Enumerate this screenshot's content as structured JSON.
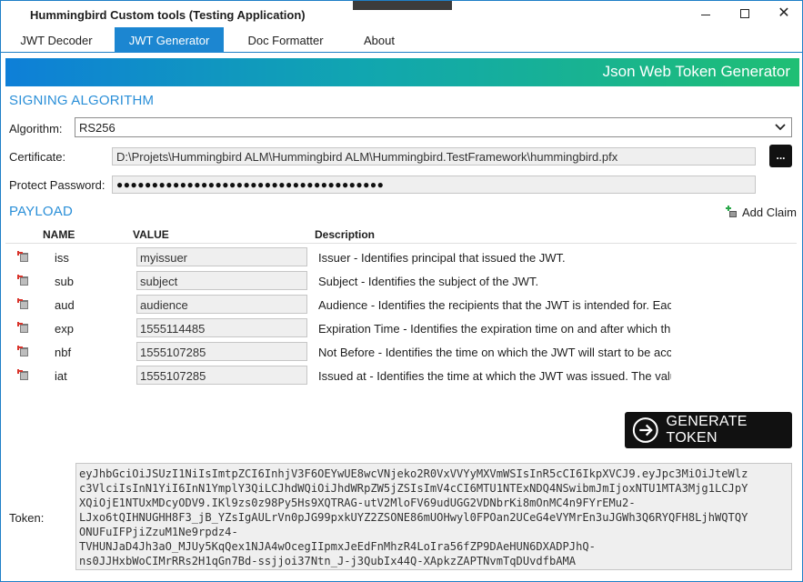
{
  "window": {
    "title": "Hummingbird Custom tools (Testing Application)"
  },
  "tabs": [
    {
      "label": "JWT Decoder"
    },
    {
      "label": "JWT Generator"
    },
    {
      "label": "Doc Formatter"
    },
    {
      "label": "About"
    }
  ],
  "active_tab": "JWT Generator",
  "header": {
    "title": "Json Web Token Generator"
  },
  "signing": {
    "section_title": "SIGNING ALGORITHM",
    "algorithm_label": "Algorithm:",
    "algorithm_value": "RS256",
    "certificate_label": "Certificate:",
    "certificate_value": "D:\\Projets\\Hummingbird ALM\\Hummingbird ALM\\Hummingbird.TestFramework\\hummingbird.pfx",
    "browse_label": "...",
    "password_label": "Protect Password:",
    "password_value": "●●●●●●●●●●●●●●●●●●●●●●●●●●●●●●●●●●●●●●"
  },
  "payload": {
    "section_title": "PAYLOAD",
    "add_claim_label": "Add Claim",
    "columns": {
      "name": "NAME",
      "value": "VALUE",
      "description": "Description"
    },
    "claims": [
      {
        "name": "iss",
        "value": "myissuer",
        "description": "Issuer - Identifies principal that issued the JWT."
      },
      {
        "name": "sub",
        "value": "subject",
        "description": "Subject - Identifies the subject of the JWT."
      },
      {
        "name": "aud",
        "value": "audience",
        "description": "Audience - Identifies the recipients that the JWT is intended for. Eac"
      },
      {
        "name": "exp",
        "value": "1555114485",
        "description": "Expiration Time - Identifies the expiration time on and after which th"
      },
      {
        "name": "nbf",
        "value": "1555107285",
        "description": "Not Before - Identifies the time on which the JWT will start to be acc"
      },
      {
        "name": "iat",
        "value": "1555107285",
        "description": "Issued at - Identifies the time at which the JWT was issued. The valu"
      }
    ]
  },
  "generate": {
    "label": "GENERATE TOKEN"
  },
  "token": {
    "label": "Token:",
    "value": "eyJhbGciOiJSUzI1NiIsImtpZCI6InhjV3F6OEYwUE8wcVNjeko2R0VxVVYyMXVmWSIsInR5cCI6IkpXVCJ9.eyJpc3MiOiJteWlz\nc3VlciIsInN1YiI6InN1YmplY3QiLCJhdWQiOiJhdWRpZW5jZSIsImV4cCI6MTU1NTExNDQ4NSwibmJmIjoxNTU1MTA3Mjg1LCJpY\nXQiOjE1NTUxMDcyODV9.IKl9zs0z98Py5Hs9XQTRAG-utV2MloFV69udUGG2VDNbrKi8mOnMC4n9FYrEMu2-\nLJxo6tQIHNUGHH8F3_jB_YZsIgAULrVn0pJG99pxkUYZ2ZSONE86mUOHwyl0FPOan2UCeG4eVYMrEn3uJGWh3Q6RYQFH8LjhWQTQY\nONUFuIFPjiZzuM1Ne9rpdz4-\nTVHUNJaD4Jh3aO_MJUy5KqQex1NJA4wOcegIIpmxJeEdFnMhzR4LoIra56fZP9DAeHUN6DXADPJhQ-\nns0JJHxbWoCIMrRRs2H1qGn7Bd-ssjjoi37Ntn_J-j3QubIx44Q-XApkzZAPTNvmTqDUvdfbAMA"
  }
}
